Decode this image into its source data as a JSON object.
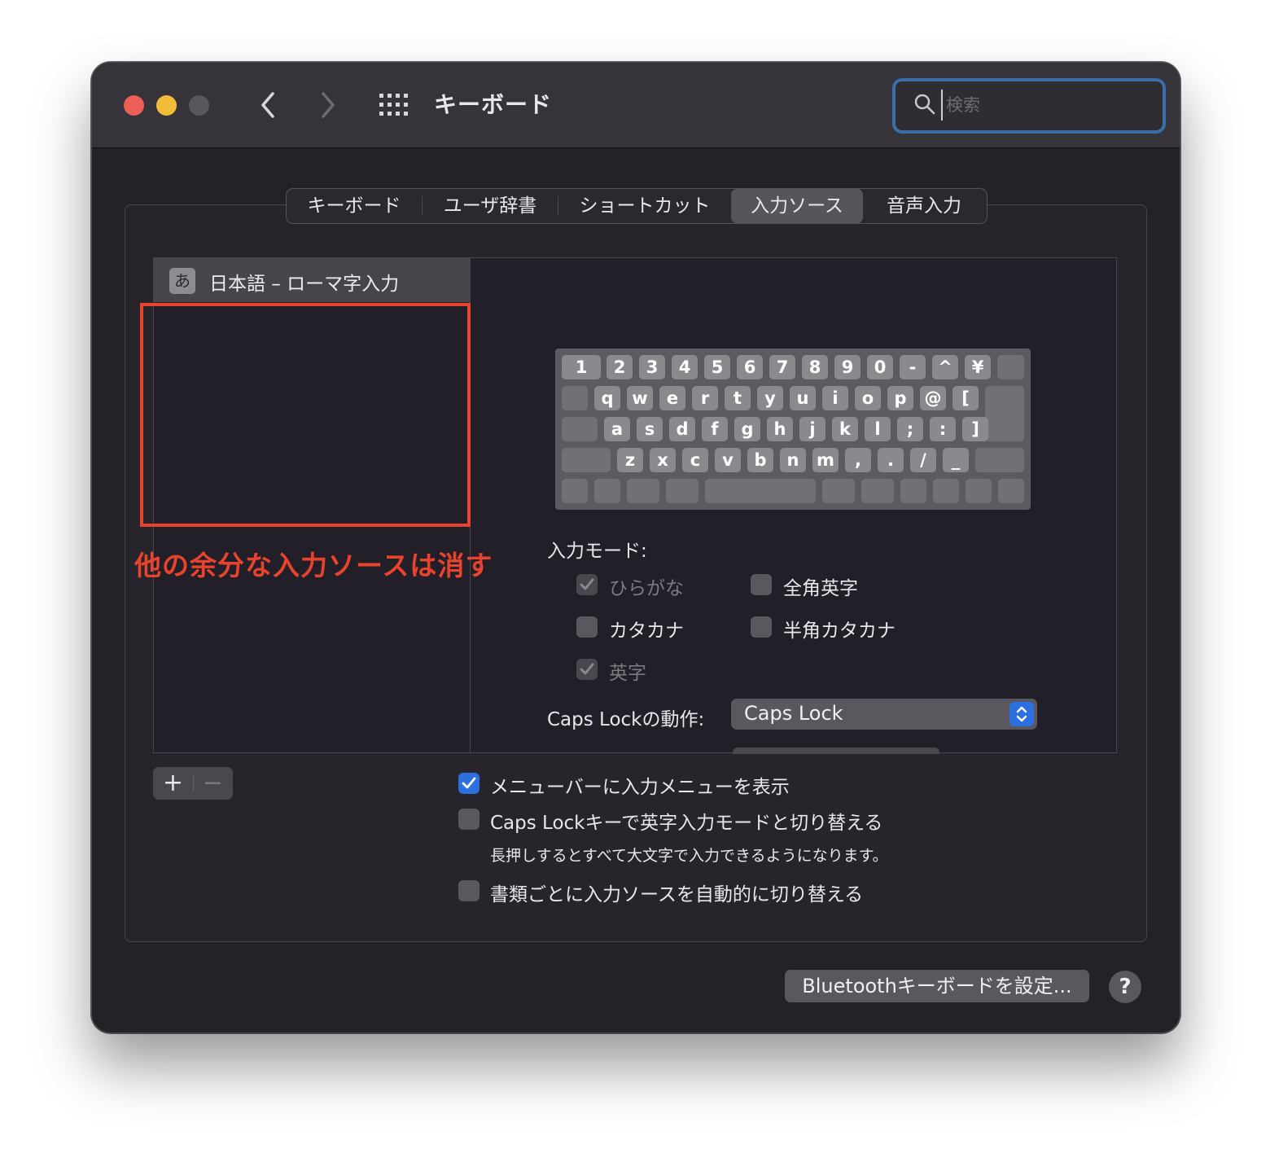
{
  "window": {
    "title": "キーボード",
    "search_placeholder": "検索"
  },
  "tabs": [
    {
      "label": "キーボード",
      "active": false
    },
    {
      "label": "ユーザ辞書",
      "active": false
    },
    {
      "label": "ショートカット",
      "active": false
    },
    {
      "label": "入力ソース",
      "active": true
    },
    {
      "label": "音声入力",
      "active": false
    }
  ],
  "input_sources": {
    "items": [
      {
        "badge": "あ",
        "label": "日本語 – ローマ字入力"
      }
    ]
  },
  "annotation": {
    "text": "他の余分な入力ソースは消す",
    "color": "#e8432d"
  },
  "keyboard": {
    "row1": [
      "1",
      "2",
      "3",
      "4",
      "5",
      "6",
      "7",
      "8",
      "9",
      "0",
      "-",
      "^",
      "¥"
    ],
    "row2": [
      "q",
      "w",
      "e",
      "r",
      "t",
      "y",
      "u",
      "i",
      "o",
      "p",
      "@",
      "["
    ],
    "row3": [
      "a",
      "s",
      "d",
      "f",
      "g",
      "h",
      "j",
      "k",
      "l",
      ";",
      ":",
      "]"
    ],
    "row4": [
      "z",
      "x",
      "c",
      "v",
      "b",
      "n",
      "m",
      ",",
      ".",
      "/",
      "_"
    ]
  },
  "input_modes": {
    "title": "入力モード:",
    "options": [
      {
        "label": "ひらがな",
        "checked": true,
        "disabled": true
      },
      {
        "label": "全角英字",
        "checked": false,
        "disabled": false
      },
      {
        "label": "カタカナ",
        "checked": false,
        "disabled": false
      },
      {
        "label": "半角カタカナ",
        "checked": false,
        "disabled": false
      },
      {
        "label": "英字",
        "checked": true,
        "disabled": true
      }
    ]
  },
  "caps_lock": {
    "label": "Caps Lockの動作:",
    "value": "Caps Lock"
  },
  "options": {
    "show_menu": {
      "label": "メニューバーに入力メニューを表示",
      "checked": true
    },
    "caps_switch": {
      "label": "Caps Lockキーで英字入力モードと切り替える",
      "checked": false,
      "note": "長押しするとすべて大文字で入力できるようになります。"
    },
    "auto_switch": {
      "label": "書類ごとに入力ソースを自動的に切り替える",
      "checked": false
    }
  },
  "buttons": {
    "add": "+",
    "remove": "−",
    "bluetooth": "Bluetoothキーボードを設定...",
    "help": "?"
  },
  "colors": {
    "accent": "#2c6fe0",
    "annotation": "#e8432d",
    "window_bg": "#242129"
  }
}
